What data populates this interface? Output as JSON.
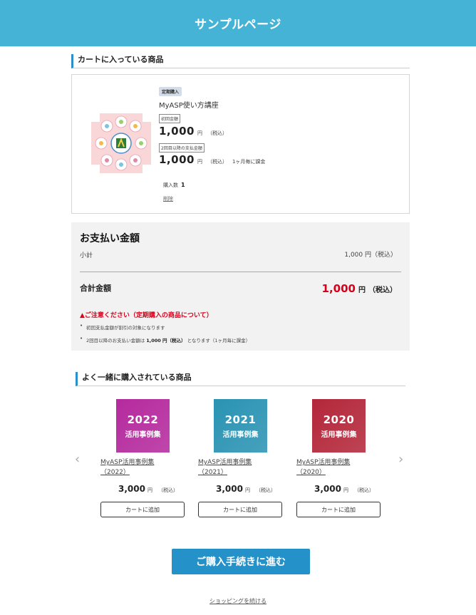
{
  "header": {
    "title": "サンプルページ"
  },
  "cart_section": {
    "title": "カートに入っている商品",
    "item": {
      "badge": "定期購入",
      "name": "MyASP使い方講座",
      "first_price_label": "初回金額",
      "first_price": "1,000",
      "recurring_price_label": "2回目以降の支払金額",
      "recurring_price": "1,000",
      "unit": "円",
      "tax": "（税込）",
      "recurring_note": "1ヶ月毎に課金",
      "quantity_label": "購入数",
      "quantity": "1",
      "delete_label": "削除"
    }
  },
  "payment": {
    "title": "お支払い金額",
    "subtotal_label": "小計",
    "subtotal_value": "1,000 円（税込）",
    "total_label": "合計金額",
    "total_value": "1,000",
    "total_unit": "円",
    "total_tax": "（税込）",
    "caution": "▲ご注意ください（定期購入の商品について）",
    "notes": [
      "初回支払金額が割引の対象になります",
      {
        "prefix": "2回目以降のお支払い金額は",
        "bold": "1,000 円（税込）",
        "suffix": "となります（1ヶ月毎に課金）"
      }
    ]
  },
  "recommendations": {
    "title": "よく一緒に購入されている商品",
    "prev_arrow": "‹",
    "next_arrow": "›",
    "items": [
      {
        "year": "2022",
        "book_title": "活用事例集",
        "name_line1": "MyASP活用事例集",
        "name_line2": "（2022）",
        "price": "3,000",
        "unit": "円",
        "tax": "（税込）",
        "button": "カートに追加",
        "color": "#b52a9e"
      },
      {
        "year": "2021",
        "book_title": "活用事例集",
        "name_line1": "MyASP活用事例集",
        "name_line2": "（2021）",
        "price": "3,000",
        "unit": "円",
        "tax": "（税込）",
        "button": "カートに追加",
        "color": "#2a93b3"
      },
      {
        "year": "2020",
        "book_title": "活用事例集",
        "name_line1": "MyASP活用事例集",
        "name_line2": "（2020）",
        "price": "3,000",
        "unit": "円",
        "tax": "（税込）",
        "button": "カートに追加",
        "color": "#b3273a"
      }
    ]
  },
  "checkout_button": "ご購入手続きに進む",
  "continue_link": "ショッピングを続ける",
  "colors": {
    "header": "#45b3d6",
    "accent": "#2591c9",
    "price_red": "#d9001b"
  }
}
